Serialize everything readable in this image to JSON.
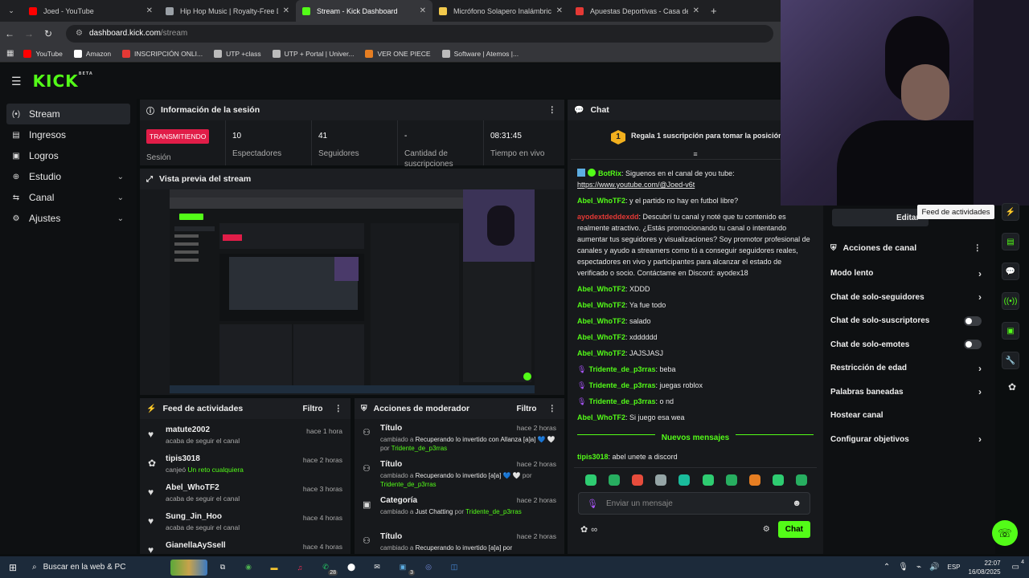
{
  "browser": {
    "tabs": [
      {
        "title": "Joed - YouTube",
        "color": "#ff0000"
      },
      {
        "title": "Hip Hop Music | Royalty-Free D",
        "color": "#9aa0a6"
      },
      {
        "title": "Stream - Kick Dashboard",
        "color": "#53fc18"
      },
      {
        "title": "Micrófono Solapero Inalámbric",
        "color": "#f2c94c"
      },
      {
        "title": "Apuestas Deportivas - Casa de /",
        "color": "#e53935"
      }
    ],
    "url_domain": "dashboard.kick.com",
    "url_path": "/stream",
    "bookmarks": [
      {
        "label": "YouTube",
        "color": "#ff0000"
      },
      {
        "label": "Amazon",
        "color": "#ffffff"
      },
      {
        "label": "INSCRIPCIÓN ONLI...",
        "color": "#e53935"
      },
      {
        "label": "UTP +class",
        "color": "#bbbbbb"
      },
      {
        "label": "UTP + Portal | Univer...",
        "color": "#bbbbbb"
      },
      {
        "label": "VER ONE PIECE",
        "color": "#e67e22"
      },
      {
        "label": "Software | Atemos |...",
        "color": "#bbbbbb"
      }
    ]
  },
  "kick": {
    "logo": "KICK",
    "logo_badge": "BETA"
  },
  "sidebar": {
    "items": [
      {
        "label": "Stream",
        "icon": "(•)",
        "chev": ""
      },
      {
        "label": "Ingresos",
        "icon": "▤",
        "chev": ""
      },
      {
        "label": "Logros",
        "icon": "▣",
        "chev": ""
      },
      {
        "label": "Estudio",
        "icon": "⊕",
        "chev": "⌄"
      },
      {
        "label": "Canal",
        "icon": "⇆",
        "chev": "⌄"
      },
      {
        "label": "Ajustes",
        "icon": "⚙",
        "chev": "⌄"
      }
    ]
  },
  "session": {
    "title": "Información de la sesión",
    "badge": "TRANSMITIENDO",
    "badge_label": "Sesión",
    "stats": [
      {
        "value": "10",
        "label": "Espectadores"
      },
      {
        "value": "41",
        "label": "Seguidores"
      },
      {
        "value": "-",
        "label": "Cantidad de suscripciones"
      },
      {
        "value": "08:31:45",
        "label": "Tiempo en vivo"
      }
    ]
  },
  "preview": {
    "title": "Vista previa del stream"
  },
  "feed": {
    "title": "Feed de actividades",
    "filter": "Filtro",
    "items": [
      {
        "name": "matute2002",
        "sub": "acaba de seguir el canal",
        "sub_green": "",
        "time": "hace 1 hora",
        "icon": "♥"
      },
      {
        "name": "tipis3018",
        "sub": "canjeó ",
        "sub_green": "Un reto cualquiera",
        "time": "hace 2 horas",
        "icon": "✿"
      },
      {
        "name": "Abel_WhoTF2",
        "sub": "acaba de seguir el canal",
        "sub_green": "",
        "time": "hace 3 horas",
        "icon": "♥"
      },
      {
        "name": "Sung_Jin_Hoo",
        "sub": "acaba de seguir el canal",
        "sub_green": "",
        "time": "hace 4 horas",
        "icon": "♥"
      },
      {
        "name": "GianellaAySsell",
        "sub": "",
        "sub_green": "",
        "time": "hace 4 horas",
        "icon": "♥"
      }
    ]
  },
  "moderator": {
    "title": "Acciones de moderador",
    "filter": "Filtro",
    "items": [
      {
        "name": "Título",
        "a": "cambiado a ",
        "b": "Recuperando lo invertido con Allanza [a]a] 💙 🤍",
        "c": " por ",
        "d": "Tridente_de_p3rras",
        "time": "hace 2 horas"
      },
      {
        "name": "Título",
        "a": "cambiado a ",
        "b": "Recuperando lo invertido [a]a] 💙 🤍",
        "c": " por ",
        "d": "Tridente_de_p3rras",
        "time": "hace 2 horas"
      },
      {
        "name": "Categoría",
        "a": "cambiado a ",
        "b": "Just Chatting",
        "c": " por ",
        "d": "Tridente_de_p3rras",
        "time": "hace 2 horas"
      },
      {
        "name": "Título",
        "a": "cambiado a ",
        "b": "Recuperando lo invertido [a]a] por",
        "c": "",
        "d": "",
        "time": "hace 2 horas"
      }
    ]
  },
  "chat": {
    "title": "Chat",
    "promo": "Regala 1 suscripción para tomar la posición 1",
    "promo_rank": "1",
    "messages": [
      {
        "user": "BotRix",
        "color": "#53fc18",
        "text": ": Siguenos en el canal de you tube: ",
        "link": "https://www.youtube.com/@Joed-v6t",
        "badge": true
      },
      {
        "user": "Abel_WhoTF2",
        "color": "#53fc18",
        "text": ": y el partido no hay en futbol libre?",
        "link": ""
      },
      {
        "user": "ayodextdeddexdd",
        "color": "#e53935",
        "text": ": Descubrí tu canal y noté que tu contenido es realmente atractivo. ¿Estás promocionando tu canal o intentando aumentar tus seguidores y visualizaciones? Soy promotor profesional de canales y ayudo a streamers como tú a conseguir seguidores reales, espectadores en vivo y participantes para alcanzar el estado de verificado o socio. Contáctame en Discord: ayodex18",
        "link": ""
      },
      {
        "user": "Abel_WhoTF2",
        "color": "#53fc18",
        "text": ": XDDD",
        "link": ""
      },
      {
        "user": "Abel_WhoTF2",
        "color": "#53fc18",
        "text": ": Ya fue todo",
        "link": ""
      },
      {
        "user": "Abel_WhoTF2",
        "color": "#53fc18",
        "text": ": salado",
        "link": ""
      },
      {
        "user": "Abel_WhoTF2",
        "color": "#53fc18",
        "text": ": xdddddd",
        "link": ""
      },
      {
        "user": "Abel_WhoTF2",
        "color": "#53fc18",
        "text": ": JAJSJASJ",
        "link": ""
      },
      {
        "user": "Tridente_de_p3rras",
        "color": "#53fc18",
        "text": ": beba",
        "link": "",
        "mic": true
      },
      {
        "user": "Tridente_de_p3rras",
        "color": "#53fc18",
        "text": ": juegas roblox",
        "link": "",
        "mic": true
      },
      {
        "user": "Tridente_de_p3rras",
        "color": "#53fc18",
        "text": ": o nd",
        "link": "",
        "mic": true
      },
      {
        "user": "Abel_WhoTF2",
        "color": "#53fc18",
        "text": ": Si juego esa wea",
        "link": ""
      }
    ],
    "new_messages": "Nuevos mensajes",
    "last_message": {
      "user": "tipis3018",
      "text": ": abel unete a discord"
    },
    "input_placeholder": "Enviar un mensaje",
    "send_label": "Chat",
    "emote_colors": [
      "#2ecc71",
      "#27ae60",
      "#e74c3c",
      "#95a5a6",
      "#1abc9c",
      "#2ecc71",
      "#27ae60",
      "#e67e22",
      "#2ecc71",
      "#27ae60"
    ]
  },
  "channel": {
    "edit_label": "Editar",
    "tooltip": "Feed de actividades",
    "title": "Acciones de canal",
    "actions": [
      {
        "label": "Modo lento",
        "type": "chev"
      },
      {
        "label": "Chat de solo-seguidores",
        "type": "chev"
      },
      {
        "label": "Chat de solo-suscriptores",
        "type": "toggle"
      },
      {
        "label": "Chat de solo-emotes",
        "type": "toggle"
      },
      {
        "label": "Restricción de edad",
        "type": "chev"
      },
      {
        "label": "Palabras baneadas",
        "type": "chev"
      },
      {
        "label": "Hostear canal",
        "type": "none"
      },
      {
        "label": "Configurar objetivos",
        "type": "chev"
      }
    ]
  },
  "taskbar": {
    "search": "Buscar en la web & PC",
    "lang": "ESP",
    "time": "22:07",
    "date": "16/08/2025",
    "badge_whatsapp": "28",
    "badge_other": "3",
    "notif": "4"
  }
}
